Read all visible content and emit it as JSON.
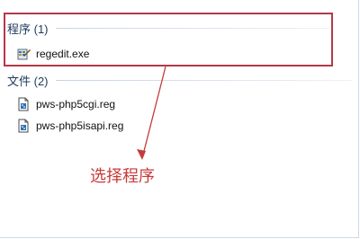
{
  "groups": [
    {
      "title": "程序 (1)",
      "items": [
        {
          "label": "regedit.exe",
          "icon": "regedit-icon"
        }
      ]
    },
    {
      "title": "文件 (2)",
      "items": [
        {
          "label": "pws-php5cgi.reg",
          "icon": "reg-file-icon"
        },
        {
          "label": "pws-php5isapi.reg",
          "icon": "reg-file-icon"
        }
      ]
    }
  ],
  "annotation": {
    "text": "选择程序",
    "color": "#c63b3b"
  },
  "colors": {
    "highlight_box": "#b23a48",
    "group_header": "#1e395b"
  }
}
